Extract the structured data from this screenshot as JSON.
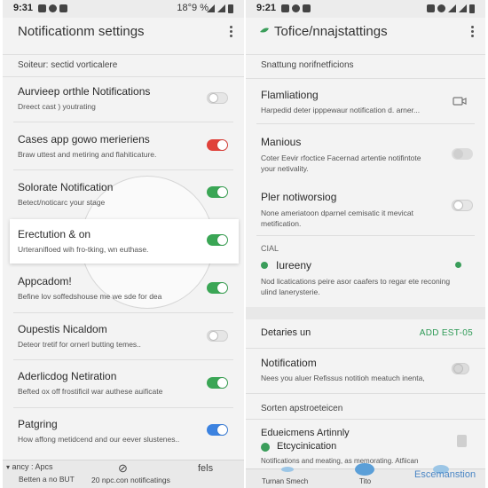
{
  "colors": {
    "green": "#3aa655",
    "red": "#e0413a",
    "blue": "#3b82e0",
    "link": "#2e9a56"
  },
  "left": {
    "status": {
      "time": "9:31",
      "right_text": "18°9 %"
    },
    "title": "Notificationm settings",
    "section": "Soiteur: sectid vorticalere",
    "rows": [
      {
        "title": "Aurvieep orthle Notifications",
        "subtitle": "Dreect cast ) youtrating",
        "toggle": "off",
        "color": ""
      },
      {
        "title": "Cases app gowo merieriens",
        "subtitle": "Braw uttest and metiring and flahiticature.",
        "toggle": "on",
        "color": "#e0413a"
      },
      {
        "title": "Solorate Notification",
        "subtitle": "Betect/noticarc your stage",
        "toggle": "on",
        "color": "#3aa655"
      },
      {
        "title": "Erectution & on",
        "subtitle": "Urteranifloed wih fro-tking, wn euthase.",
        "toggle": "on",
        "color": "#3aa655"
      },
      {
        "title": "Appcadom!",
        "subtitle": "Befine lov soffedshouse me we sde for dea",
        "toggle": "on",
        "color": "#3aa655"
      },
      {
        "title": "Oupestis Nicaldom",
        "subtitle": "Deteor tretif for ornerl butting temes..",
        "toggle": "off",
        "color": ""
      },
      {
        "title": "Aderlicdog Netiration",
        "subtitle": "Befted ox off frostificil war authese auificate",
        "toggle": "on",
        "color": "#3aa655"
      },
      {
        "title": "Patgring",
        "subtitle": "How affong metidcend and our eever slustenes..",
        "toggle": "on",
        "color": "#3b82e0"
      }
    ],
    "bottom": {
      "left_title": "ancy : Apcs",
      "left_sub": "Betten a no BUT",
      "mid": "20 npc.con notificatings",
      "right": "fels"
    }
  },
  "right": {
    "status": {
      "time": "9:21"
    },
    "title": "Tofice/nnajstattings",
    "section1": "Snattung norifnetficions",
    "rows": [
      {
        "title": "Flamliationg",
        "subtitle": "Harpedid deter ipppewaur notification d. arner..."
      },
      {
        "title": "Manious",
        "subtitle": "Coter Eevir rfoctice Facernad artentie notifintote your netivality."
      },
      {
        "title": "Pler notiworsiog",
        "subtitle": "None ameriatoon dparnel cemisatic it mevicat metification."
      }
    ],
    "ciai": "CIAL",
    "lureeny": {
      "title": "Iureeny",
      "subtitle": "Nod licatications peire asor caafers to regar ete reconing ulind lanerysterie."
    },
    "destinations": {
      "label": "Detaries un",
      "action": "ADD EST-05"
    },
    "notification_row": {
      "title": "Notificatiom",
      "subtitle": "Nees you aluer Refissus notitioh meatuch inenta,"
    },
    "section2": "Sorten apstroeteicen",
    "edu": {
      "title": "Edueicmens Artinnly",
      "item": "Etcycinication",
      "sub": "Notifications and meating, as memorating. Atfiican"
    },
    "bottom": {
      "left": "Turnan Smech",
      "mid": "Tito",
      "right": "Escemanstion"
    }
  }
}
